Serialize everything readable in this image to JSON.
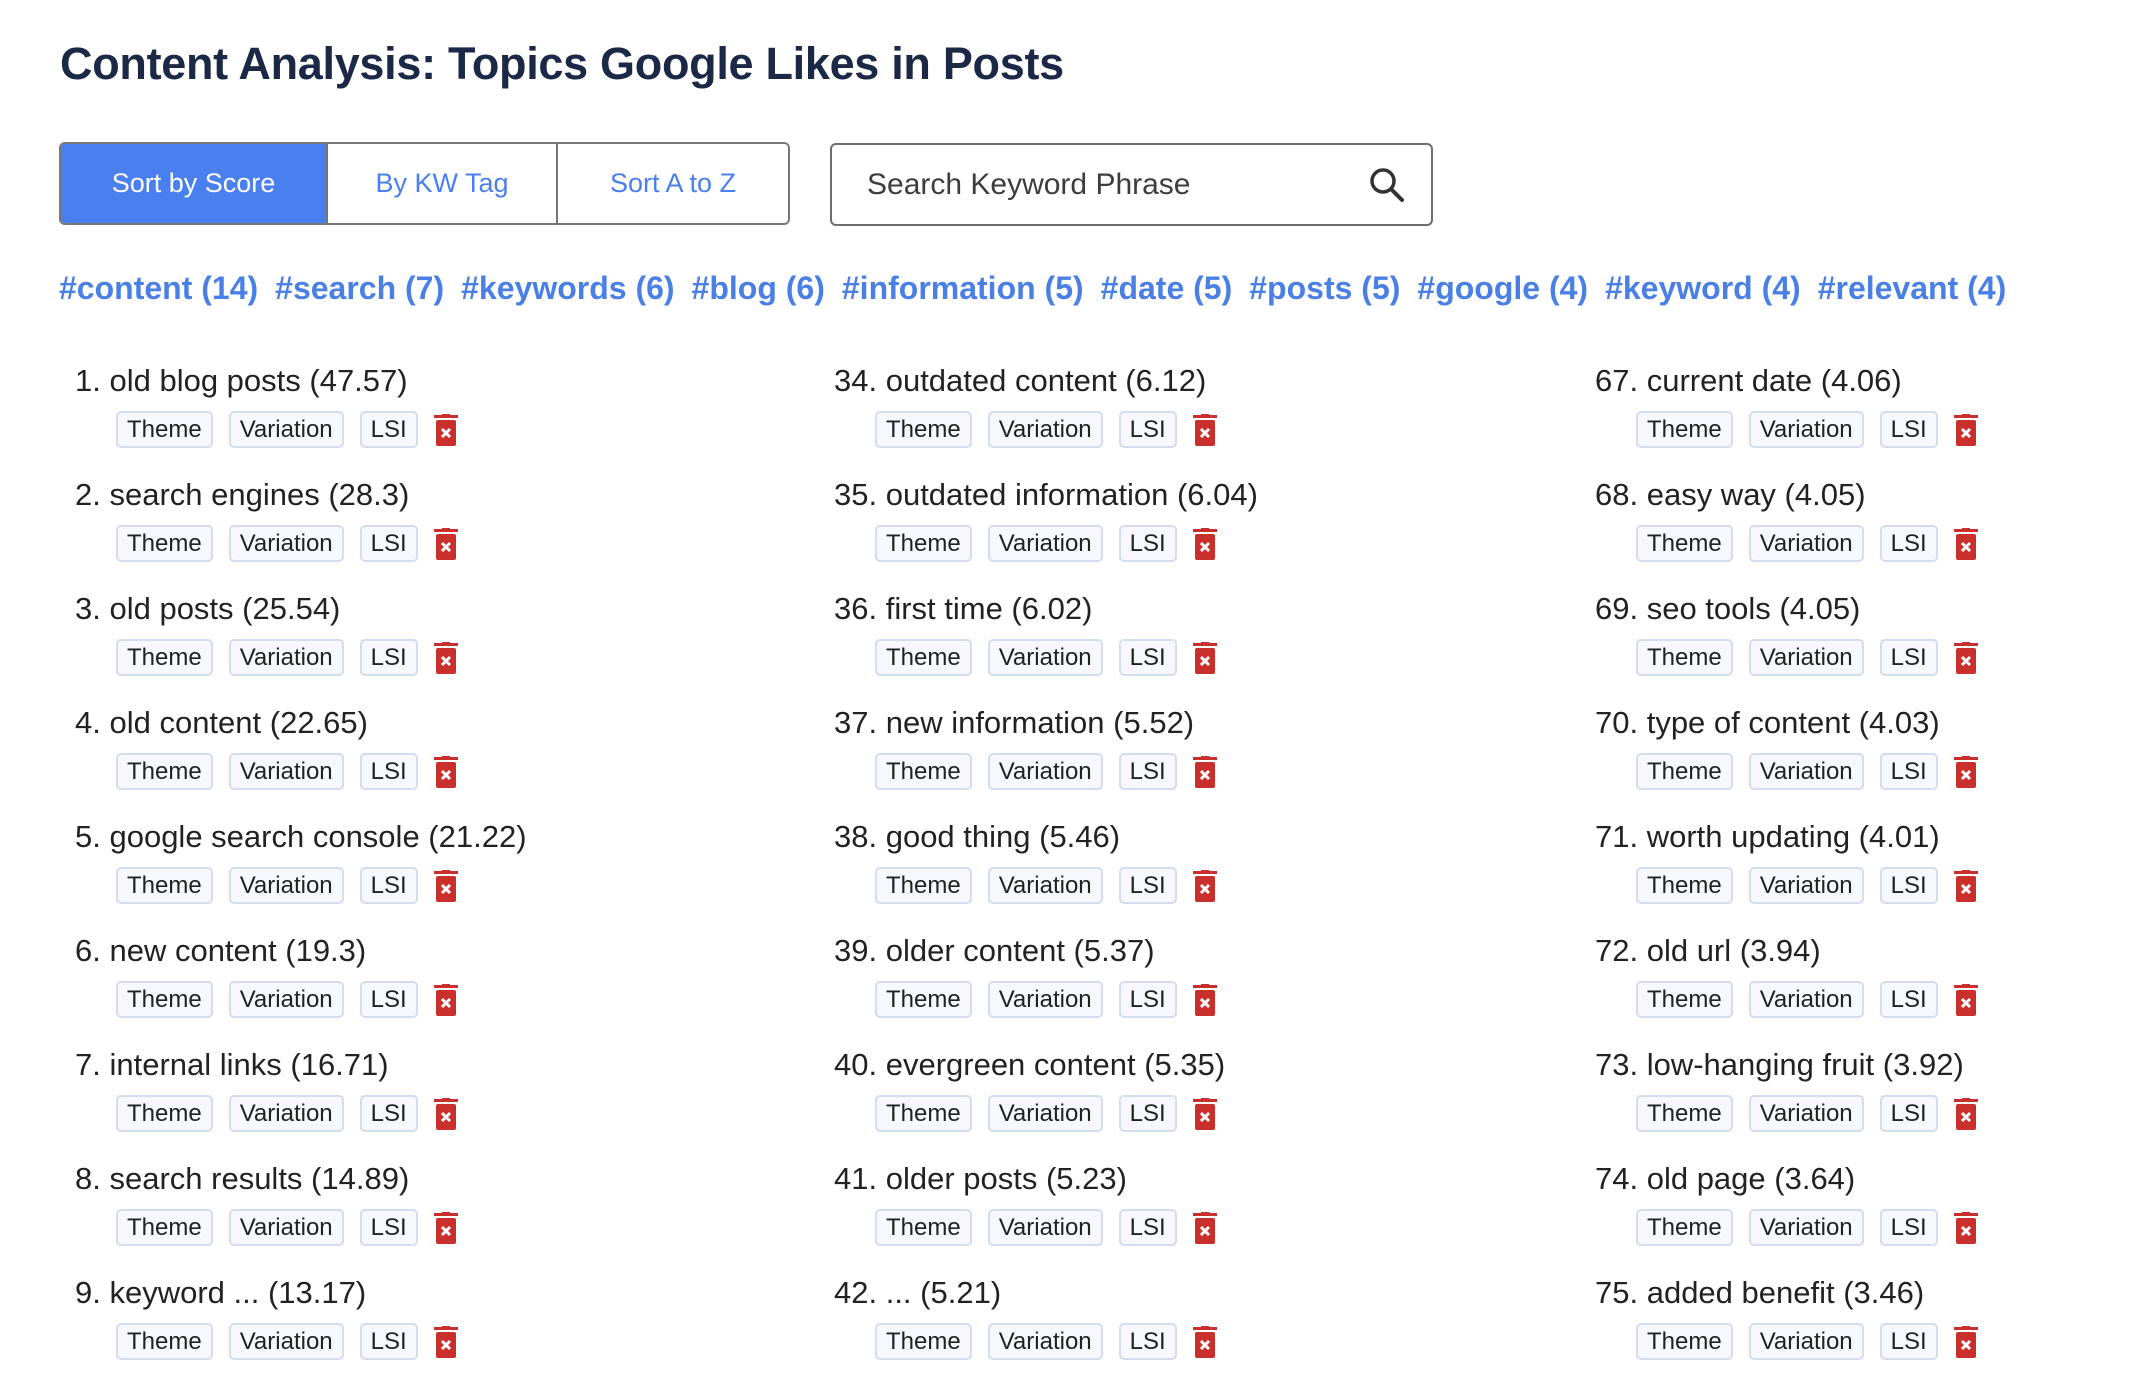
{
  "page": {
    "title": "Content Analysis: Topics Google Likes in Posts"
  },
  "sort_buttons": [
    {
      "label": "Sort by Score",
      "active": true
    },
    {
      "label": "By KW Tag",
      "active": false
    },
    {
      "label": "Sort A to Z",
      "active": false
    }
  ],
  "search": {
    "placeholder": "Search Keyword Phrase",
    "value": "",
    "icon": "search-icon"
  },
  "hashtags": [
    "#content (14)",
    "#search (7)",
    "#keywords (6)",
    "#blog (6)",
    "#information (5)",
    "#date (5)",
    "#posts (5)",
    "#google (4)",
    "#keyword (4)",
    "#relevant (4)"
  ],
  "pill_labels": [
    "Theme",
    "Variation",
    "LSI"
  ],
  "delete_icon": "trash-delete-icon",
  "colors": {
    "accent": "#4a7ff0",
    "title": "#1b2846",
    "delete": "#c9302c",
    "pill_border": "#d3ddef"
  },
  "columns": [
    [
      "1. old blog posts (47.57)",
      "2. search engines (28.3)",
      "3. old posts (25.54)",
      "4. old content (22.65)",
      "5. google search console (21.22)",
      "6. new content (19.3)",
      "7. internal links (16.71)",
      "8. search results (14.89)",
      "9. keyword ... (13.17)"
    ],
    [
      "34. outdated content (6.12)",
      "35. outdated information (6.04)",
      "36. first time (6.02)",
      "37. new information (5.52)",
      "38. good thing (5.46)",
      "39. older content (5.37)",
      "40. evergreen content (5.35)",
      "41. older posts (5.23)",
      "42. ... (5.21)"
    ],
    [
      "67. current date (4.06)",
      "68. easy way (4.05)",
      "69. seo tools (4.05)",
      "70. type of content (4.03)",
      "71. worth updating (4.01)",
      "72. old url (3.94)",
      "73. low-hanging fruit (3.92)",
      "74. old page (3.64)",
      "75. added benefit (3.46)"
    ]
  ]
}
